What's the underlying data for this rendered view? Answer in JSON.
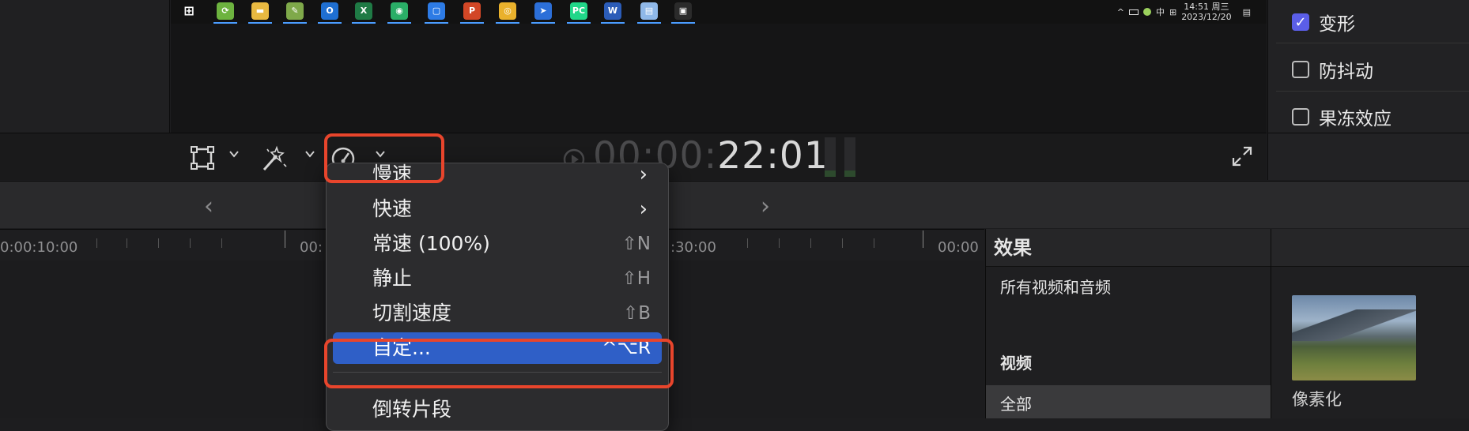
{
  "taskbar": {
    "apps": [
      {
        "name": "windows-start-icon",
        "glyph": "⊞",
        "color": "#121212"
      },
      {
        "name": "app-green-icon",
        "glyph": "⟳",
        "color": "#6db33f"
      },
      {
        "name": "file-explorer-icon",
        "glyph": "▬",
        "color": "#e8b941"
      },
      {
        "name": "notepad-icon",
        "glyph": "✎",
        "color": "#7fa94a"
      },
      {
        "name": "outlook-icon",
        "glyph": "O",
        "color": "#1f6fd1"
      },
      {
        "name": "excel-icon",
        "glyph": "X",
        "color": "#1f7a45"
      },
      {
        "name": "wechat-icon",
        "glyph": "◉",
        "color": "#2aae67"
      },
      {
        "name": "blue-app-icon",
        "glyph": "▢",
        "color": "#2d7be5"
      },
      {
        "name": "powerpoint-icon",
        "glyph": "P",
        "color": "#d24726"
      },
      {
        "name": "chrome-icon",
        "glyph": "◎",
        "color": "#e9b12c"
      },
      {
        "name": "arrow-app-icon",
        "glyph": "➤",
        "color": "#2c6fd8"
      },
      {
        "name": "pycharm-icon",
        "glyph": "PC",
        "color": "#21d789"
      },
      {
        "name": "word-icon",
        "glyph": "W",
        "color": "#2b5cb8"
      },
      {
        "name": "blue-file-icon",
        "glyph": "▤",
        "color": "#8fb8e8"
      },
      {
        "name": "chat-app-icon",
        "glyph": "▣",
        "color": "#2b2b2b"
      }
    ],
    "tray": {
      "caret": "^",
      "ime": "中",
      "grid": "⊞",
      "time": "14:51 周三",
      "date": "2023/12/20",
      "notify": "▤"
    }
  },
  "inspector": {
    "items": [
      {
        "label": "变形",
        "checked": true
      },
      {
        "label": "防抖动",
        "checked": false
      },
      {
        "label": "果冻效应",
        "checked": false
      }
    ]
  },
  "viewer": {
    "timecode_dim": "00:00:",
    "timecode_bright": "22:01",
    "fullscreen": "⤢"
  },
  "nav": {
    "prev": "‹",
    "next": "›"
  },
  "ruler": {
    "labels": [
      "0:00:10:00",
      "00:",
      ":30:00",
      "00:00"
    ]
  },
  "menu": {
    "items": [
      {
        "label": "慢速",
        "shortcut": "",
        "submenu": true
      },
      {
        "label": "快速",
        "shortcut": "",
        "submenu": true
      },
      {
        "label": "常速 (100%)",
        "shortcut": "⇧N",
        "submenu": false
      },
      {
        "label": "静止",
        "shortcut": "⇧H",
        "submenu": false
      },
      {
        "label": "切割速度",
        "shortcut": "⇧B",
        "submenu": false
      },
      {
        "label": "自定...",
        "shortcut": "^⌥R",
        "submenu": false
      },
      {
        "label": "倒转片段",
        "shortcut": "",
        "submenu": false
      }
    ],
    "arrow": "›"
  },
  "effects": {
    "header": "效果",
    "all": "所有视频和音频",
    "video": "视频",
    "all_selected": "全部"
  },
  "browser": {
    "thumb_label": "像素化"
  },
  "colors": {
    "accent": "#2f5fc7",
    "highlight": "#e8452c",
    "checkbox": "#5b5ee8"
  }
}
